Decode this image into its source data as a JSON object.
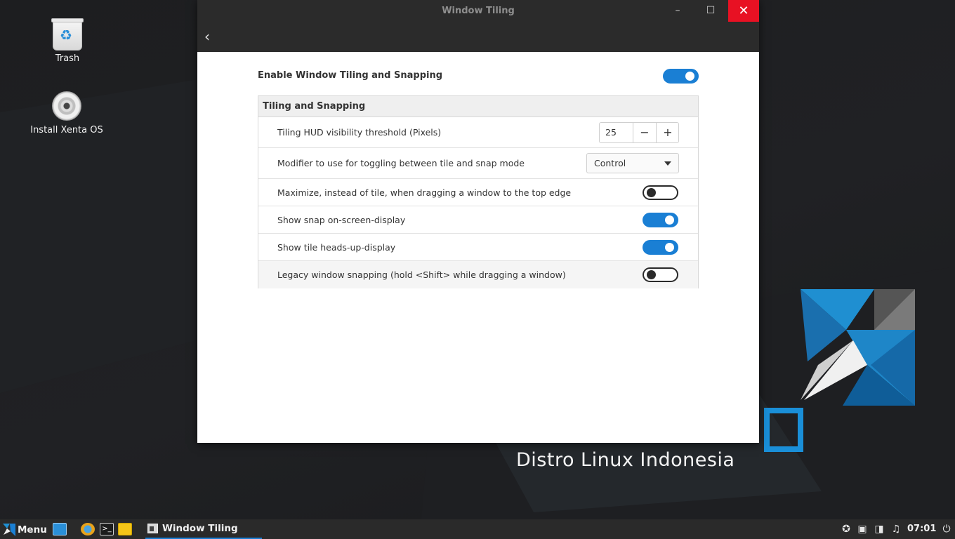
{
  "desktop": {
    "icons": [
      {
        "label": "Trash"
      },
      {
        "label": "Install Xenta OS"
      }
    ],
    "wallpaper_text": "Distro Linux Indonesia"
  },
  "window": {
    "title": "Window Tiling",
    "controls": {
      "minimize": "–",
      "maximize": "☐",
      "close": "✕"
    },
    "back_icon": "‹"
  },
  "settings": {
    "enable": {
      "label": "Enable Window Tiling and Snapping",
      "on": true
    },
    "section_title": "Tiling and Snapping",
    "hud_threshold": {
      "label": "Tiling HUD visibility threshold (Pixels)",
      "value": "25",
      "minus": "−",
      "plus": "+"
    },
    "modifier": {
      "label": "Modifier to use for toggling between tile and snap mode",
      "value": "Control"
    },
    "maximize": {
      "label": "Maximize, instead of tile, when dragging a window to the top edge",
      "on": false
    },
    "snap_osd": {
      "label": "Show snap on-screen-display",
      "on": true
    },
    "tile_hud": {
      "label": "Show tile heads-up-display",
      "on": true
    },
    "legacy": {
      "label": "Legacy window snapping (hold <Shift> while dragging a window)",
      "on": false
    }
  },
  "taskbar": {
    "menu_label": "Menu",
    "active_task": "Window Tiling",
    "clock": "07:01",
    "tray_icons": [
      "accessibility-icon",
      "screenshot-icon",
      "network-icon",
      "sound-icon",
      "power-icon"
    ]
  },
  "colors": {
    "accent": "#1a7fd4",
    "close": "#e81123",
    "titlebar": "#2b2b2b"
  }
}
